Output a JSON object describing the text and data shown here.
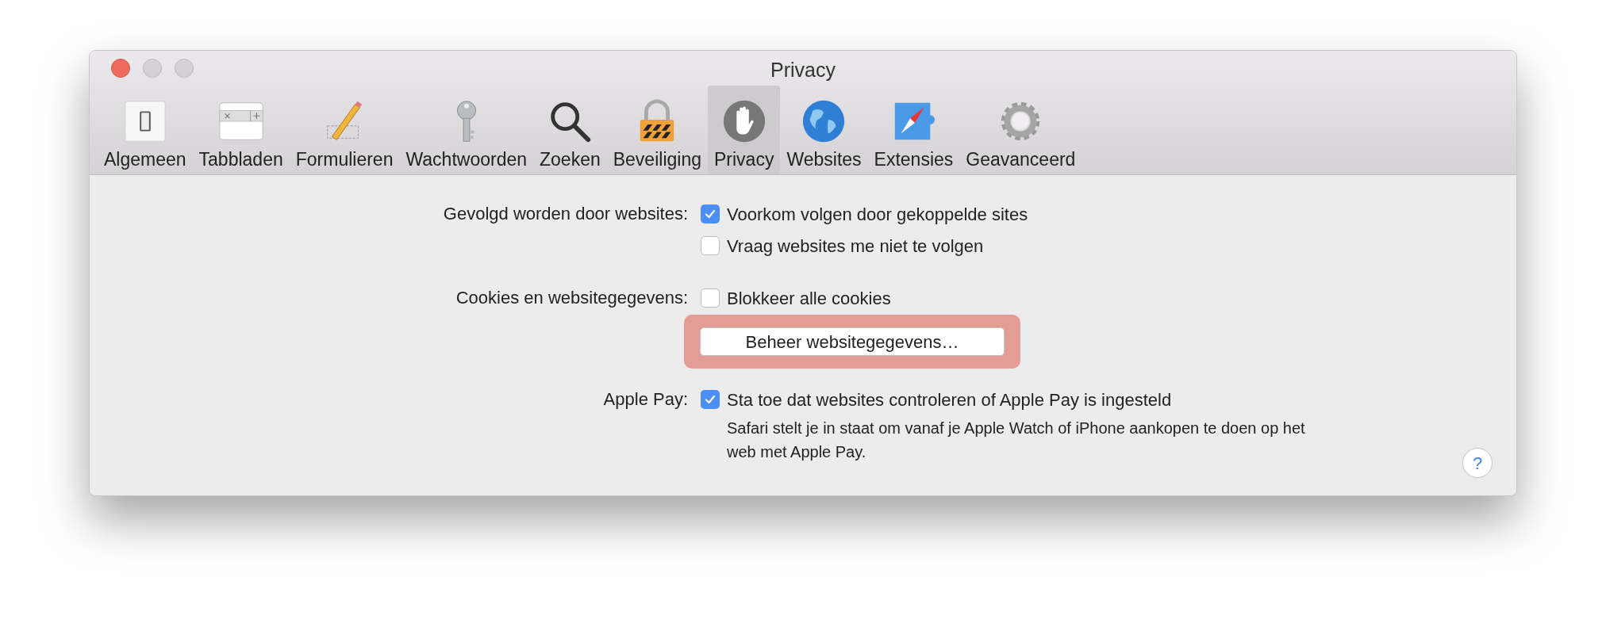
{
  "window": {
    "title": "Privacy"
  },
  "toolbar": [
    {
      "label": "Algemeen",
      "selected": false
    },
    {
      "label": "Tabbladen",
      "selected": false
    },
    {
      "label": "Formulieren",
      "selected": false
    },
    {
      "label": "Wachtwoorden",
      "selected": false
    },
    {
      "label": "Zoeken",
      "selected": false
    },
    {
      "label": "Beveiliging",
      "selected": false
    },
    {
      "label": "Privacy",
      "selected": true
    },
    {
      "label": "Websites",
      "selected": false
    },
    {
      "label": "Extensies",
      "selected": false
    },
    {
      "label": "Geavanceerd",
      "selected": false
    }
  ],
  "sections": [
    {
      "label": "Gevolgd worden door websites:",
      "items": [
        {
          "kind": "checkbox",
          "label": "Voorkom volgen door gekoppelde sites",
          "checked": true
        },
        {
          "kind": "checkbox",
          "label": "Vraag websites me niet te volgen",
          "checked": false
        }
      ]
    },
    {
      "label": "Cookies en websitegegevens:",
      "items": [
        {
          "kind": "checkbox",
          "label": "Blokkeer alle cookies",
          "checked": false
        },
        {
          "kind": "button",
          "label": "Beheer websitegegevens…",
          "highlighted": true
        }
      ]
    },
    {
      "label": "Apple Pay:",
      "items": [
        {
          "kind": "checkbox",
          "label": "Sta toe dat websites controleren of Apple Pay is ingesteld",
          "checked": true,
          "note": "Safari stelt je in staat om vanaf je Apple Watch of iPhone aankopen te doen op het web met Apple Pay."
        }
      ]
    }
  ],
  "help": {
    "label": "?"
  }
}
